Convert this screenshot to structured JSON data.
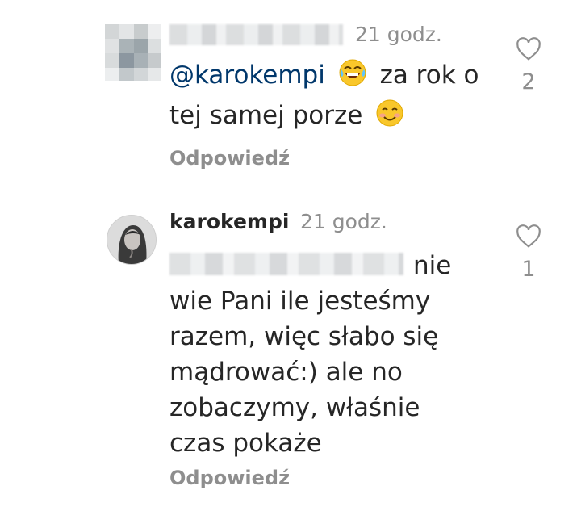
{
  "comments": [
    {
      "author_redacted": true,
      "time": "21 godz.",
      "mention": "@karokempi",
      "line1_after_mention": "za rok o",
      "line2": "tej samej porze",
      "reply_label": "Odpowiedź",
      "likes": "2",
      "emoji": [
        "laughing-tears-emoji",
        "smiling-emoji"
      ]
    },
    {
      "author": "karokempi",
      "time": "21 godz.",
      "lines": [
        "nie",
        "wie Pani ile jesteśmy",
        "razem, więc słabo się",
        "mądrować:) ale no",
        "zobaczymy, właśnie",
        "czas pokaże"
      ],
      "reply_label": "Odpowiedź",
      "likes": "1"
    }
  ],
  "colors": {
    "text": "#262626",
    "secondary": "#8e8e8e",
    "mention": "#00376b"
  }
}
